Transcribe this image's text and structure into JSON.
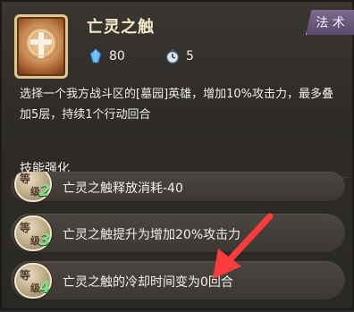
{
  "header": {
    "title": "亡灵之触",
    "type_badge": "法 术",
    "stats": {
      "mana_cost": "80",
      "cooldown": "5"
    }
  },
  "description": "选择一个我方战斗区的[墓园]英雄，增加10%攻击力，最多叠加5层，持续1个行动回合",
  "enhancements": {
    "section_title": "技能强化",
    "rows": [
      {
        "level_char_1": "等",
        "level_char_2": "级",
        "level": "2",
        "text": "亡灵之触释放消耗-40"
      },
      {
        "level_char_1": "等",
        "level_char_2": "级",
        "level": "3",
        "text": "亡灵之触提升为增加20%攻击力"
      },
      {
        "level_char_1": "等",
        "level_char_2": "级",
        "level": "4",
        "text": "亡灵之触的冷却时间变为0回合"
      }
    ]
  },
  "colors": {
    "panel_bg": "#2f2c28",
    "title_text": "#f4e8c8",
    "level_number": "#7fe28a",
    "badge_purple": "#6b5a7b",
    "annotation_arrow": "#ff3b3b"
  },
  "icons": {
    "card": "undead-card-icon",
    "mana": "mana-crystal-icon",
    "cooldown": "stopwatch-icon",
    "annotation": "red-arrow-icon"
  }
}
